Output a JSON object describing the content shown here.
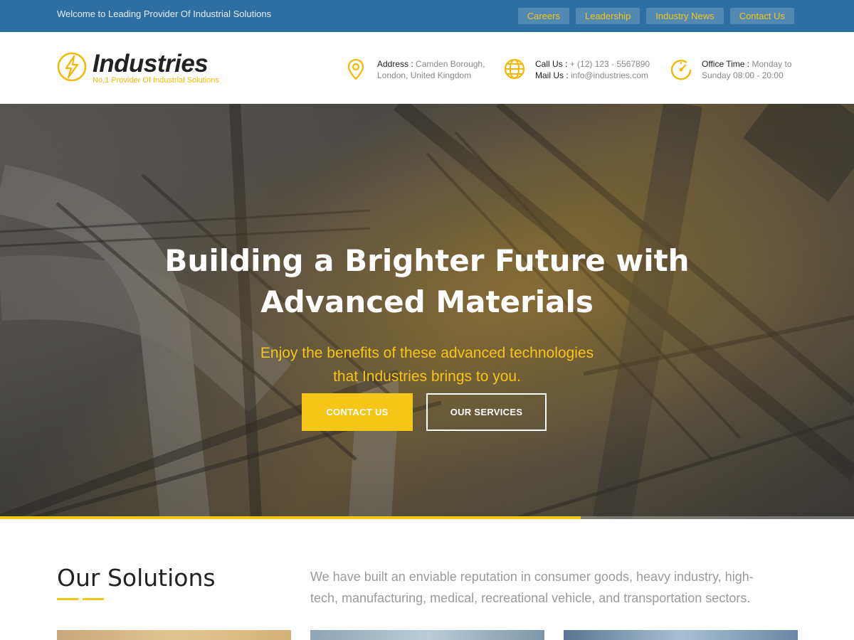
{
  "topbar": {
    "welcome": "Welcome to Leading Provider Of Industrial Solutions",
    "links": [
      "Careers",
      "Leadership",
      "Industry News",
      "Contact Us"
    ]
  },
  "header": {
    "logo_title": "Industries",
    "logo_sub": "No.1 Provider Of Industrial Solutions",
    "address_label": "Address :",
    "address_line1": "Camden Borough,",
    "address_line2": "London, United Kingdom",
    "call_label": "Call Us :",
    "call_value": "+ (12) 123 - 5567890",
    "mail_label": "Mail Us :",
    "mail_value": "info@industries.com",
    "office_label": "Office Time :",
    "office_line1": "Monday to",
    "office_line2": "Sunday 08:00 - 20:00"
  },
  "hero": {
    "title_line1": "Building a Brighter Future with",
    "title_line2": "Advanced Materials",
    "sub_line1": "Enjoy the benefits of these advanced technologies",
    "sub_line2": "that Industries brings to you.",
    "contact_button": "CONTACT US",
    "services_button": "OUR SERVICES",
    "slide_progress": 0.68
  },
  "solutions": {
    "title": "Our Solutions",
    "description": "We have built an enviable reputation in consumer goods, heavy industry, high-tech, manufacturing, medical, recreational vehicle, and transportation sectors."
  },
  "colors": {
    "topbar": "#2d6fa3",
    "accent": "#f5c518"
  }
}
